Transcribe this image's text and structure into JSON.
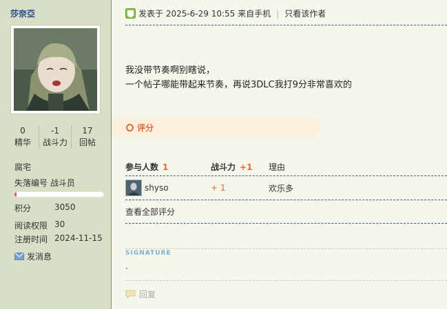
{
  "user": {
    "name": "莎奈亞",
    "stats": [
      {
        "num": "0",
        "label": "精华"
      },
      {
        "num": "-1",
        "label": "战斗力"
      },
      {
        "num": "17",
        "label": "回帖"
      }
    ],
    "rank": "腐宅",
    "group": "失落编号 战斗员",
    "progress": 0.02,
    "info": [
      {
        "k": "积分",
        "v": "3050"
      },
      {
        "k": "阅读权限",
        "v": "30"
      },
      {
        "k": "注册时间",
        "v": "2024-11-15"
      }
    ],
    "send_message": "发消息"
  },
  "post": {
    "posted_info": "发表于 2025-6-29 10:55 来自手机",
    "only_author": "只看该作者",
    "lines": [
      "我没带节奏啊别瞎说，",
      "一个帖子哪能带起来节奏，再说3DLC我打9分非常喜欢的"
    ]
  },
  "rating": {
    "title": "评分",
    "headers": {
      "participants": "参与人数",
      "participants_count": "1",
      "power": "战斗力",
      "power_total": "+1",
      "reason": "理由"
    },
    "rows": [
      {
        "user": "shyso",
        "score": "+ 1",
        "reason": "欢乐多"
      }
    ],
    "view_all": "查看全部评分"
  },
  "signature": {
    "label": "SIGNATURE",
    "text": "."
  },
  "actions": {
    "reply": "回复"
  },
  "colors": {
    "sidebar_bg": "#d8dfc7",
    "main_bg": "#f5f6ec",
    "accent_orange": "#e06a3a",
    "name_blue": "#2a4a8a",
    "progress_fill": "#e0439a"
  }
}
